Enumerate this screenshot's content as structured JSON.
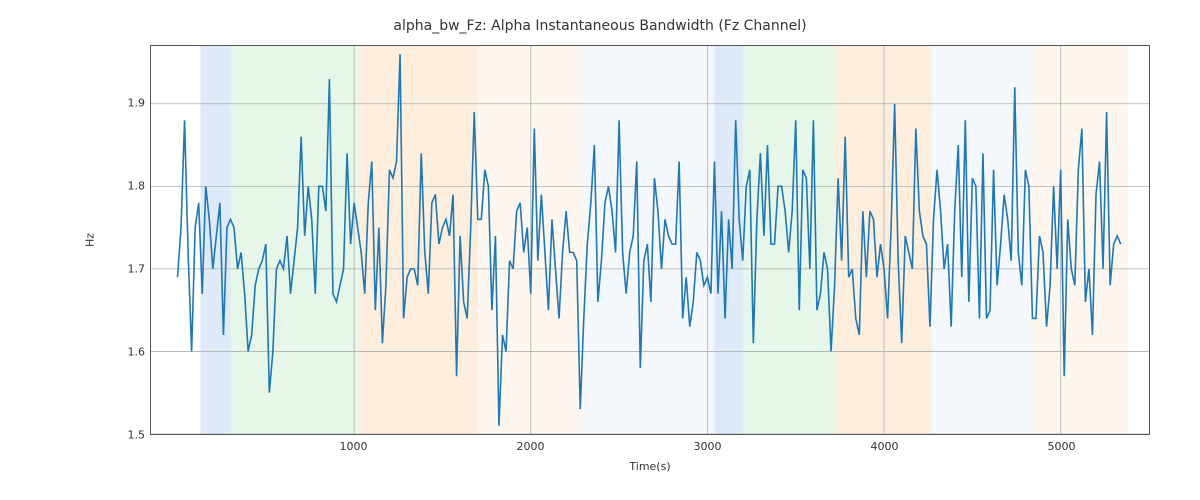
{
  "chart_data": {
    "type": "line",
    "title": "alpha_bw_Fz: Alpha Instantaneous Bandwidth (Fz Channel)",
    "xlabel": "Time(s)",
    "ylabel": "Hz",
    "xlim": [
      -150,
      5500
    ],
    "ylim": [
      1.5,
      1.97
    ],
    "xticks": [
      1000,
      2000,
      3000,
      4000,
      5000
    ],
    "yticks": [
      1.5,
      1.6,
      1.7,
      1.8,
      1.9
    ],
    "spans": [
      {
        "x0": 130,
        "x1": 300,
        "color": "#6b9edb"
      },
      {
        "x0": 300,
        "x1": 1030,
        "color": "#8fd49a"
      },
      {
        "x0": 1030,
        "x1": 1700,
        "color": "#f6b26b"
      },
      {
        "x0": 1700,
        "x1": 2300,
        "color": "#f8d9b6"
      },
      {
        "x0": 2300,
        "x1": 3040,
        "color": "#cfe0f3"
      },
      {
        "x0": 3040,
        "x1": 3200,
        "color": "#6b9edb"
      },
      {
        "x0": 3200,
        "x1": 3720,
        "color": "#8fd49a"
      },
      {
        "x0": 3720,
        "x1": 4270,
        "color": "#f6b26b"
      },
      {
        "x0": 4270,
        "x1": 4830,
        "color": "#cfe0f3"
      },
      {
        "x0": 4830,
        "x1": 5380,
        "color": "#f8d9b6"
      }
    ],
    "x": [
      0,
      20,
      40,
      60,
      80,
      100,
      120,
      140,
      160,
      180,
      200,
      220,
      240,
      260,
      280,
      300,
      320,
      340,
      360,
      380,
      400,
      420,
      440,
      460,
      480,
      500,
      520,
      540,
      560,
      580,
      600,
      620,
      640,
      660,
      680,
      700,
      720,
      740,
      760,
      780,
      800,
      820,
      840,
      860,
      880,
      900,
      920,
      940,
      960,
      980,
      1000,
      1020,
      1040,
      1060,
      1080,
      1100,
      1120,
      1140,
      1160,
      1180,
      1200,
      1220,
      1240,
      1260,
      1280,
      1300,
      1320,
      1340,
      1360,
      1380,
      1400,
      1420,
      1440,
      1460,
      1480,
      1500,
      1520,
      1540,
      1560,
      1580,
      1600,
      1620,
      1640,
      1660,
      1680,
      1700,
      1720,
      1740,
      1760,
      1780,
      1800,
      1820,
      1840,
      1860,
      1880,
      1900,
      1920,
      1940,
      1960,
      1980,
      2000,
      2020,
      2040,
      2060,
      2080,
      2100,
      2120,
      2140,
      2160,
      2180,
      2200,
      2220,
      2240,
      2260,
      2280,
      2300,
      2320,
      2340,
      2360,
      2380,
      2400,
      2420,
      2440,
      2460,
      2480,
      2500,
      2520,
      2540,
      2560,
      2580,
      2600,
      2620,
      2640,
      2660,
      2680,
      2700,
      2720,
      2740,
      2760,
      2780,
      2800,
      2820,
      2840,
      2860,
      2880,
      2900,
      2920,
      2940,
      2960,
      2980,
      3000,
      3020,
      3040,
      3060,
      3080,
      3100,
      3120,
      3140,
      3160,
      3180,
      3200,
      3220,
      3240,
      3260,
      3280,
      3300,
      3320,
      3340,
      3360,
      3380,
      3400,
      3420,
      3440,
      3460,
      3480,
      3500,
      3520,
      3540,
      3560,
      3580,
      3600,
      3620,
      3640,
      3660,
      3680,
      3700,
      3720,
      3740,
      3760,
      3780,
      3800,
      3820,
      3840,
      3860,
      3880,
      3900,
      3920,
      3940,
      3960,
      3980,
      4000,
      4020,
      4040,
      4060,
      4080,
      4100,
      4120,
      4140,
      4160,
      4180,
      4200,
      4220,
      4240,
      4260,
      4280,
      4300,
      4320,
      4340,
      4360,
      4380,
      4400,
      4420,
      4440,
      4460,
      4480,
      4500,
      4520,
      4540,
      4560,
      4580,
      4600,
      4620,
      4640,
      4660,
      4680,
      4700,
      4720,
      4740,
      4760,
      4780,
      4800,
      4820,
      4840,
      4860,
      4880,
      4900,
      4920,
      4940,
      4960,
      4980,
      5000,
      5020,
      5040,
      5060,
      5080,
      5100,
      5120,
      5140,
      5160,
      5180,
      5200,
      5220,
      5240,
      5260,
      5280,
      5300,
      5320,
      5340
    ],
    "values": [
      1.69,
      1.75,
      1.88,
      1.72,
      1.6,
      1.75,
      1.78,
      1.67,
      1.8,
      1.76,
      1.7,
      1.74,
      1.78,
      1.62,
      1.75,
      1.76,
      1.75,
      1.7,
      1.72,
      1.67,
      1.6,
      1.62,
      1.68,
      1.7,
      1.71,
      1.73,
      1.55,
      1.6,
      1.7,
      1.71,
      1.7,
      1.74,
      1.67,
      1.71,
      1.75,
      1.86,
      1.74,
      1.8,
      1.76,
      1.67,
      1.8,
      1.8,
      1.77,
      1.93,
      1.67,
      1.66,
      1.68,
      1.7,
      1.84,
      1.73,
      1.78,
      1.75,
      1.72,
      1.67,
      1.78,
      1.83,
      1.65,
      1.75,
      1.61,
      1.68,
      1.82,
      1.81,
      1.83,
      1.96,
      1.64,
      1.69,
      1.7,
      1.7,
      1.68,
      1.84,
      1.72,
      1.67,
      1.78,
      1.79,
      1.73,
      1.75,
      1.76,
      1.74,
      1.79,
      1.57,
      1.74,
      1.66,
      1.64,
      1.75,
      1.89,
      1.76,
      1.76,
      1.82,
      1.8,
      1.65,
      1.74,
      1.51,
      1.62,
      1.6,
      1.71,
      1.7,
      1.77,
      1.78,
      1.72,
      1.75,
      1.67,
      1.87,
      1.71,
      1.79,
      1.72,
      1.65,
      1.76,
      1.7,
      1.64,
      1.72,
      1.77,
      1.72,
      1.72,
      1.71,
      1.53,
      1.64,
      1.73,
      1.78,
      1.85,
      1.66,
      1.71,
      1.78,
      1.8,
      1.77,
      1.72,
      1.88,
      1.72,
      1.67,
      1.72,
      1.74,
      1.83,
      1.58,
      1.71,
      1.73,
      1.66,
      1.81,
      1.77,
      1.7,
      1.76,
      1.74,
      1.73,
      1.73,
      1.83,
      1.64,
      1.69,
      1.63,
      1.66,
      1.72,
      1.71,
      1.68,
      1.69,
      1.67,
      1.83,
      1.67,
      1.77,
      1.64,
      1.76,
      1.7,
      1.88,
      1.76,
      1.71,
      1.8,
      1.82,
      1.61,
      1.76,
      1.84,
      1.74,
      1.85,
      1.73,
      1.73,
      1.8,
      1.8,
      1.77,
      1.72,
      1.77,
      1.88,
      1.65,
      1.82,
      1.81,
      1.7,
      1.88,
      1.65,
      1.67,
      1.72,
      1.7,
      1.6,
      1.68,
      1.81,
      1.71,
      1.86,
      1.69,
      1.7,
      1.64,
      1.62,
      1.77,
      1.69,
      1.77,
      1.76,
      1.69,
      1.73,
      1.7,
      1.64,
      1.75,
      1.9,
      1.71,
      1.61,
      1.74,
      1.72,
      1.7,
      1.87,
      1.77,
      1.74,
      1.73,
      1.63,
      1.76,
      1.82,
      1.77,
      1.7,
      1.73,
      1.63,
      1.77,
      1.85,
      1.69,
      1.88,
      1.66,
      1.81,
      1.8,
      1.64,
      1.84,
      1.64,
      1.65,
      1.82,
      1.68,
      1.73,
      1.79,
      1.76,
      1.71,
      1.92,
      1.72,
      1.68,
      1.82,
      1.8,
      1.64,
      1.64,
      1.74,
      1.72,
      1.63,
      1.68,
      1.8,
      1.7,
      1.82,
      1.57,
      1.76,
      1.7,
      1.68,
      1.82,
      1.87,
      1.66,
      1.7,
      1.62,
      1.79,
      1.83,
      1.7,
      1.89,
      1.68,
      1.73,
      1.74,
      1.73
    ]
  }
}
